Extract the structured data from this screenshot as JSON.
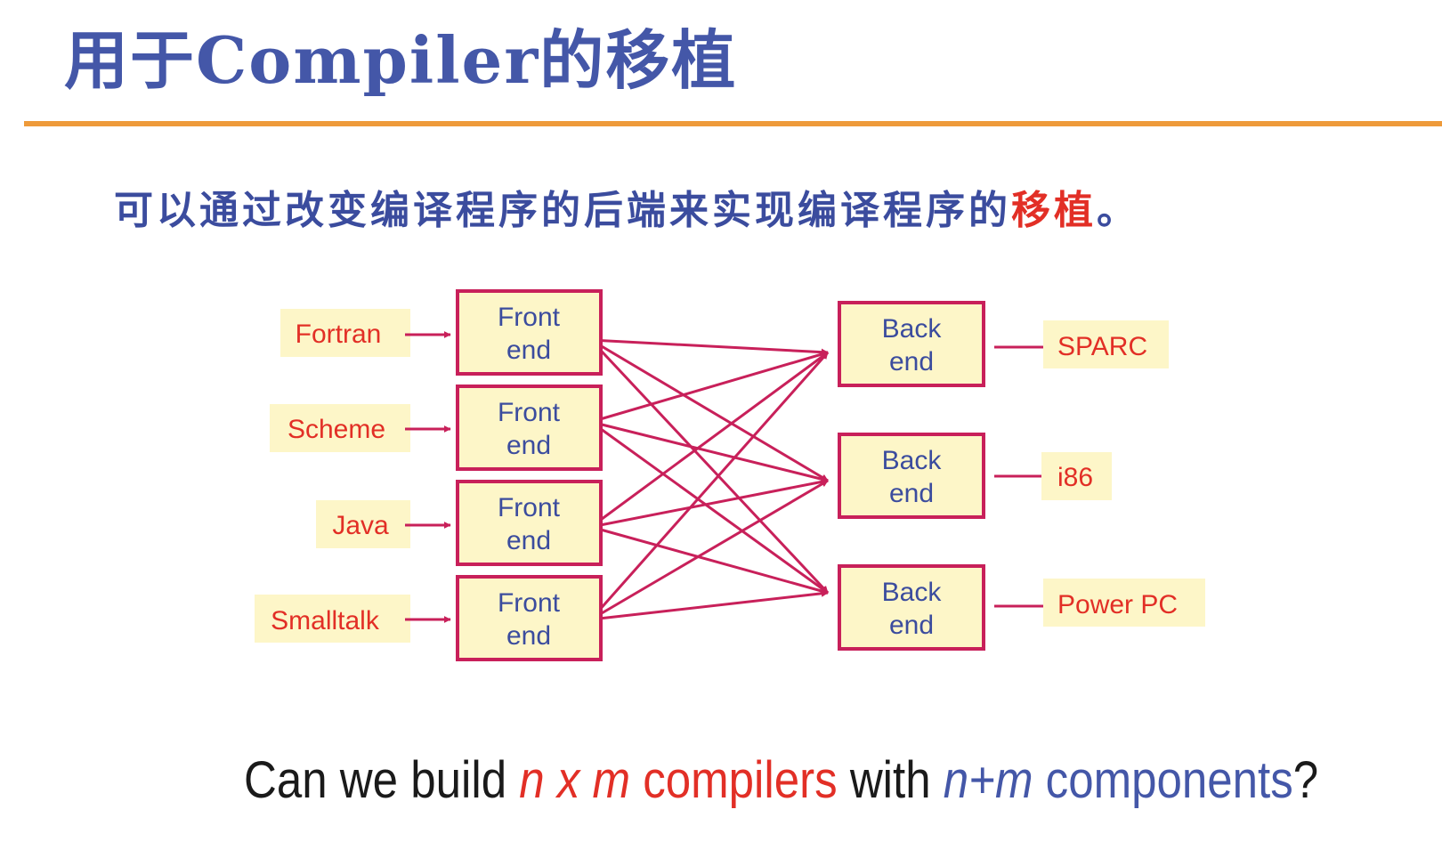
{
  "slide": {
    "title": "用于Compiler的移植",
    "subtitle_main": "可以通过改变编译程序的后端来实现编译程序的",
    "subtitle_highlight": "移植",
    "subtitle_end": "。"
  },
  "languages": [
    "Fortran",
    "Scheme",
    "Java",
    "Smalltalk"
  ],
  "front_ends": [
    {
      "line1": "Front",
      "line2": "end"
    },
    {
      "line1": "Front",
      "line2": "end"
    },
    {
      "line1": "Front",
      "line2": "end"
    },
    {
      "line1": "Front",
      "line2": "end"
    }
  ],
  "back_ends": [
    {
      "line1": "Back",
      "line2": "end"
    },
    {
      "line1": "Back",
      "line2": "end"
    },
    {
      "line1": "Back",
      "line2": "end"
    }
  ],
  "targets": [
    "SPARC",
    "i86",
    "Power PC"
  ],
  "question": {
    "p1": "Can we build ",
    "p2": "n x m",
    "p3": " compilers",
    "p4": " with ",
    "p5": "n+m",
    "p6": " components",
    "p7": "?"
  },
  "colors": {
    "title": "#4457a8",
    "rule": "#ee9a3a",
    "box_fill": "#fdf6c8",
    "box_border": "#c8205a",
    "arrow": "#c8205a",
    "label_text": "#e22f26",
    "box_text": "#3b4c9e"
  }
}
